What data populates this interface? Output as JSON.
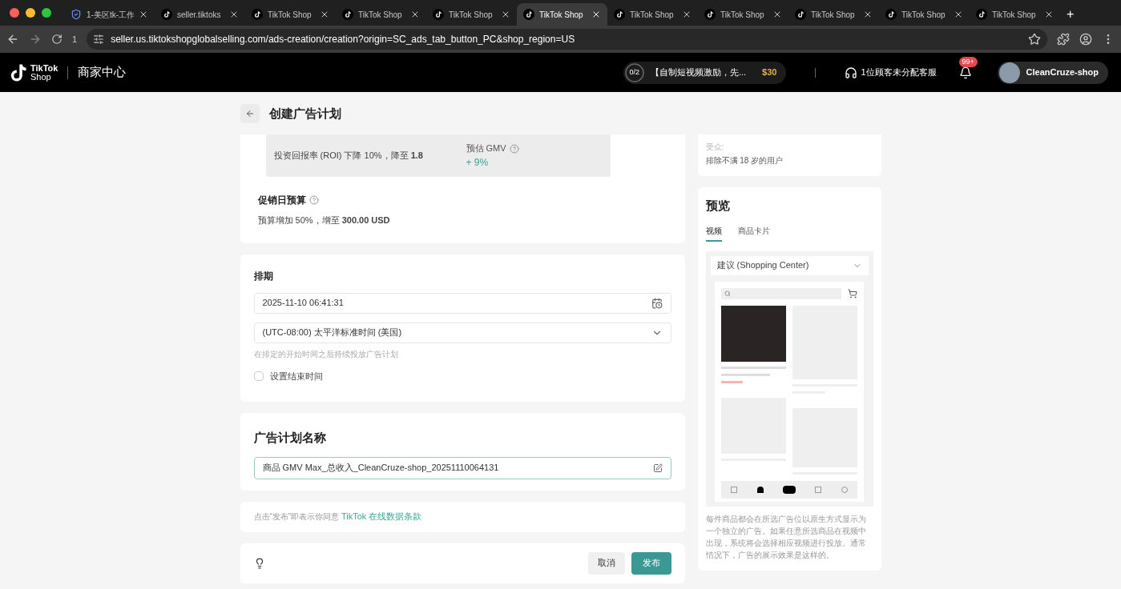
{
  "browser": {
    "tabs": [
      {
        "label": "1-美区tk-工作",
        "selected": false,
        "kind": "shield"
      },
      {
        "label": "seller.tiktoks",
        "selected": false,
        "kind": "tiktok"
      },
      {
        "label": "TikTok Shop",
        "selected": false,
        "kind": "tiktok"
      },
      {
        "label": "TikTok Shop",
        "selected": false,
        "kind": "tiktok"
      },
      {
        "label": "TikTok Shop",
        "selected": false,
        "kind": "tiktok"
      },
      {
        "label": "TikTok Shop",
        "selected": true,
        "kind": "tiktok"
      },
      {
        "label": "TikTok Shop",
        "selected": false,
        "kind": "tiktok"
      },
      {
        "label": "TikTok Shop",
        "selected": false,
        "kind": "tiktok"
      },
      {
        "label": "TikTok Shop",
        "selected": false,
        "kind": "tiktok"
      },
      {
        "label": "TikTok Shop",
        "selected": false,
        "kind": "tiktok"
      },
      {
        "label": "TikTok Shop",
        "selected": false,
        "kind": "tiktok"
      }
    ],
    "new_tab": "+",
    "reload_count": "1",
    "url": "seller.us.tiktokshopglobalselling.com/ads-creation/creation?origin=SC_ads_tab_button_PC&shop_region=US"
  },
  "header": {
    "logo_top": "TikTok",
    "logo_bottom": "Shop",
    "title": "商家中心",
    "task": {
      "progress": "0/2",
      "level": 0,
      "text": "【自制短视频激励，先...",
      "reward": "$30"
    },
    "support": "1位顾客未分配客服",
    "notification_badge": "99+",
    "shop_name": "CleanCruze-shop"
  },
  "page_title": "创建广告计划",
  "estimate": {
    "roi_text": "投资回报率 (ROI) 下降 10%，降至 **1.8**",
    "gmv_label": "预估 GMV",
    "gmv_value": "+ 9%"
  },
  "promo_budget": {
    "title": "促销日预算",
    "text": "预算增加 50%，增至 **300.00 USD**"
  },
  "schedule": {
    "title": "排期",
    "start": "2025-11-10 06:41:31",
    "timezone": "(UTC-08:00) 太平洋标准时间 (美国)",
    "hint": "在排定的开始时间之后持续投放广告计划",
    "end_time_label": "设置结束时间",
    "end_time_checked": false
  },
  "campaign_name": {
    "title": "广告计划名称",
    "value": "商品 GMV Max_总收入_CleanCruze-shop_20251110064131"
  },
  "terms": {
    "text": "点击“发布”即表示你同意 ",
    "link": "TikTok 在线数据条款"
  },
  "actions": {
    "cancel": "取消",
    "publish": "发布"
  },
  "audience": {
    "label": "受众:",
    "value": "排除不满 18 岁的用户"
  },
  "preview": {
    "title": "预览",
    "tabs": [
      {
        "label": "视频",
        "selected": true
      },
      {
        "label": "商品卡片",
        "selected": false
      }
    ],
    "placement": "建议 (Shopping Center)",
    "description": "每件商品都会在所选广告位以原生方式显示为一个独立的广告。如果任意所选商品在视频中出现，系统将会选择相应视频进行投放。通常情况下，广告的展示效果是这样的。"
  }
}
